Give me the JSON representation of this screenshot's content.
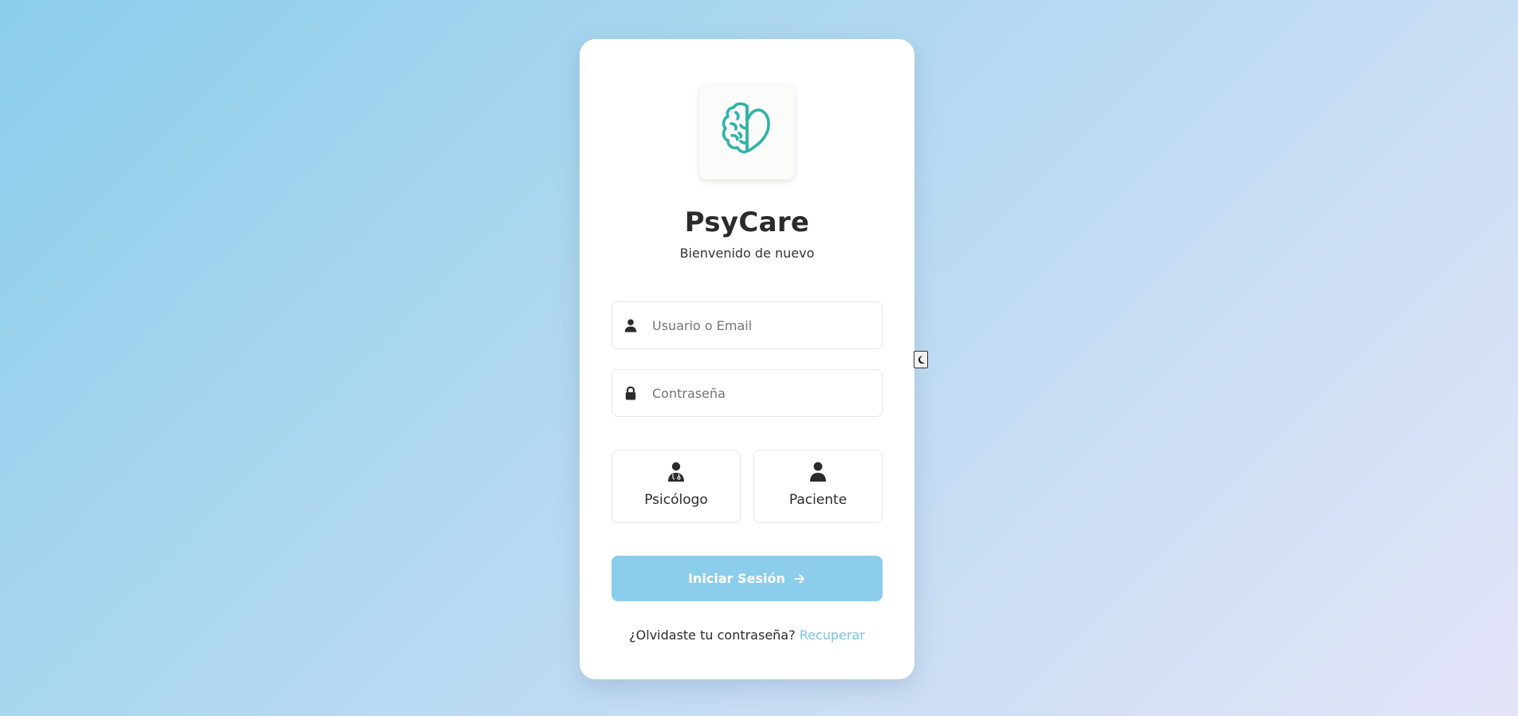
{
  "app": {
    "name": "PsyCare",
    "subtitle": "Bienvenido de nuevo"
  },
  "form": {
    "username_placeholder": "Usuario o Email",
    "username_value": "",
    "password_placeholder": "Contraseña",
    "password_value": ""
  },
  "roles": [
    {
      "label": "Psicólogo",
      "icon": "doctor-icon"
    },
    {
      "label": "Paciente",
      "icon": "user-icon"
    }
  ],
  "login_button": {
    "label": "Iniciar Sesión",
    "icon": "arrow-right-icon"
  },
  "forgot": {
    "text": "¿Olvidaste tu contraseña?",
    "link": "Recuperar"
  },
  "theme_toggle": {
    "icon": "moon-icon"
  },
  "colors": {
    "accent": "#8bcdeb",
    "logo": "#2fb3a8",
    "link": "#7cc3e6"
  }
}
